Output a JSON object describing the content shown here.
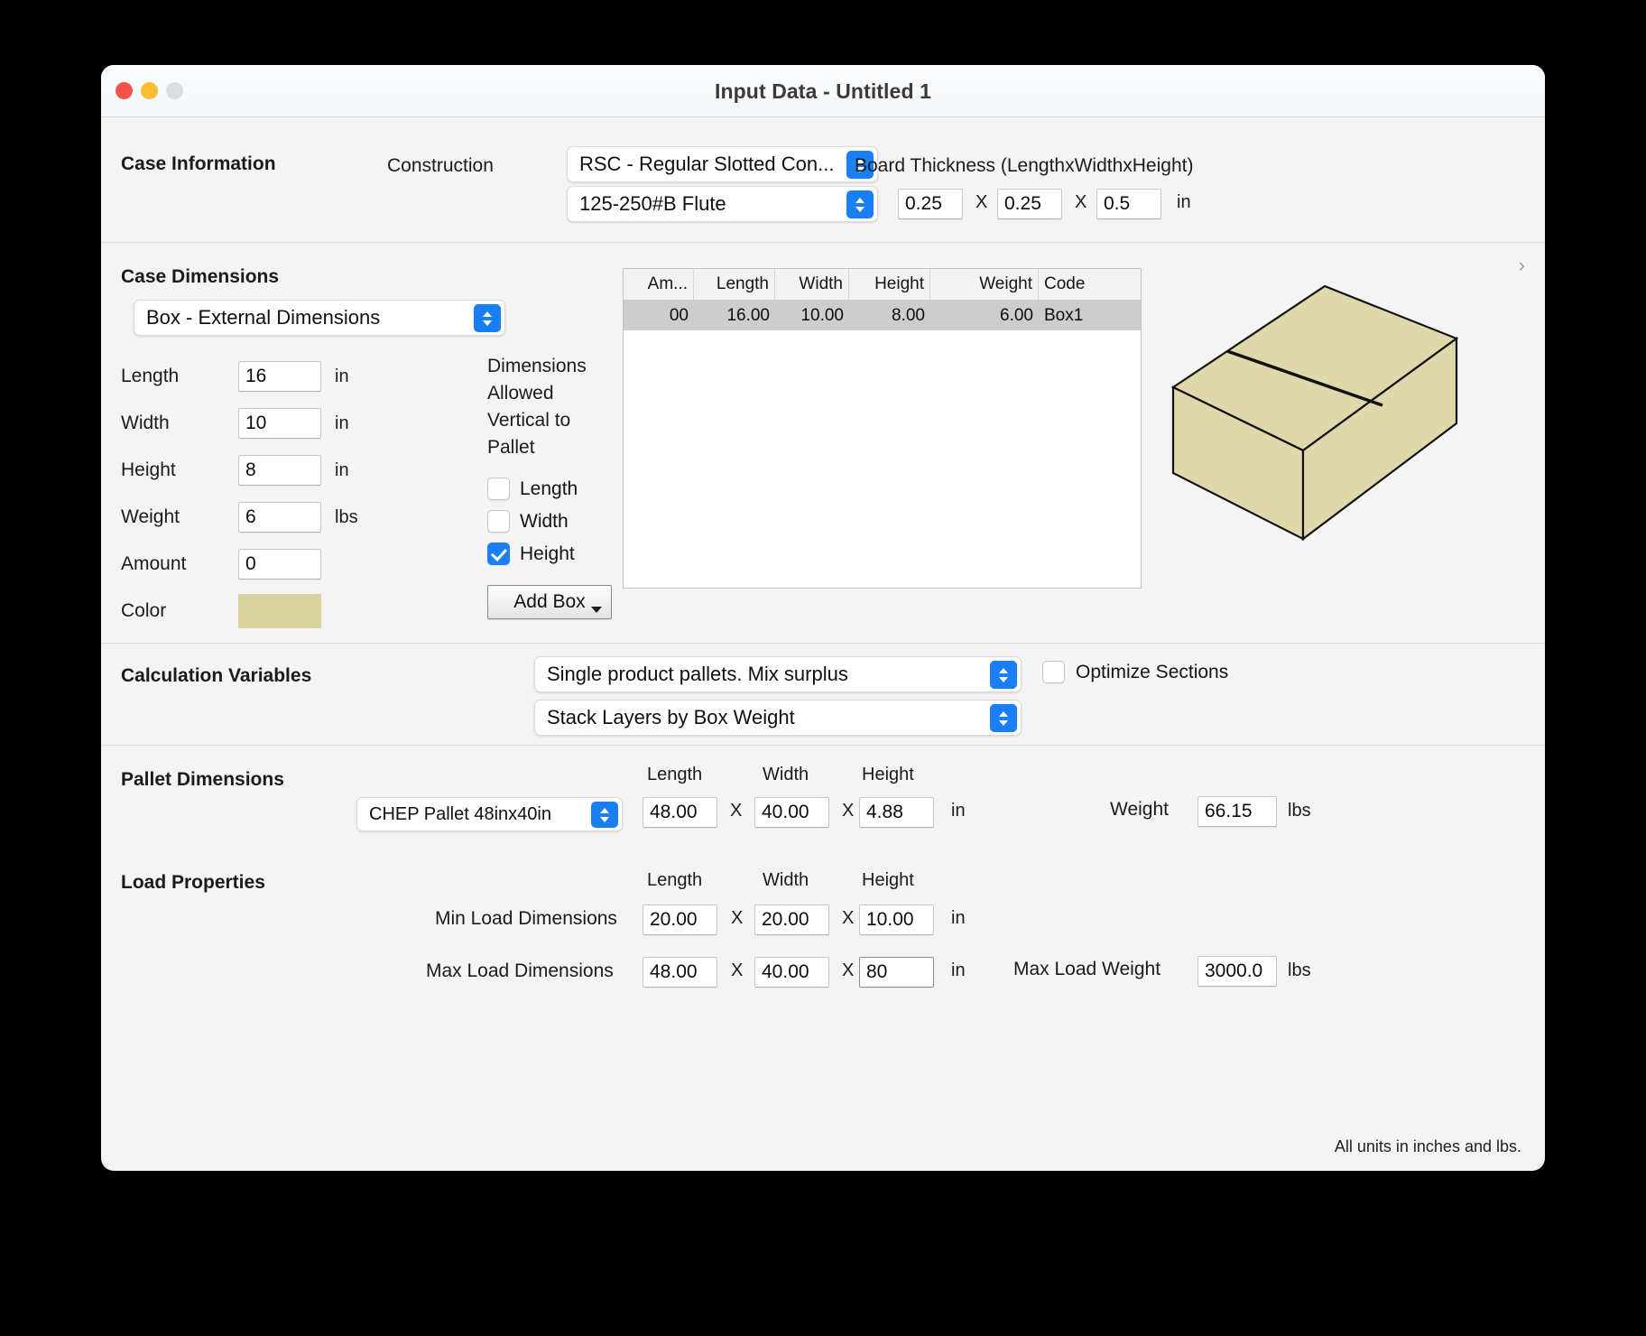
{
  "window": {
    "title": "Input Data - Untitled 1",
    "traffic_lights": [
      "close",
      "minimize",
      "zoom"
    ]
  },
  "case_information": {
    "title": "Case Information",
    "construction_label": "Construction",
    "construction_value": "RSC - Regular Slotted Con...",
    "flute_value": "125-250#B Flute",
    "board_thickness_label": "Board Thickness (LengthxWidthxHeight)",
    "thickness_length": "0.25",
    "thickness_width": "0.25",
    "thickness_height": "0.5",
    "x_sep": "X",
    "unit_in": "in"
  },
  "case_dimensions": {
    "title": "Case Dimensions",
    "mode_value": "Box - External Dimensions",
    "fields": [
      {
        "label": "Length",
        "value": "16",
        "unit": "in"
      },
      {
        "label": "Width",
        "value": "10",
        "unit": "in"
      },
      {
        "label": "Height",
        "value": "8",
        "unit": "in"
      },
      {
        "label": "Weight",
        "value": "6",
        "unit": "lbs"
      },
      {
        "label": "Amount",
        "value": "0",
        "unit": ""
      }
    ],
    "color_label": "Color",
    "color_value": "#d9d3a0",
    "vertical_title": "Dimensions Allowed Vertical to Pallet",
    "vertical_options": [
      {
        "label": "Length",
        "checked": false
      },
      {
        "label": "Width",
        "checked": false
      },
      {
        "label": "Height",
        "checked": true
      }
    ],
    "add_box_label": "Add Box",
    "table": {
      "columns": [
        "Am...",
        "Length",
        "Width",
        "Height",
        "Weight",
        "Code"
      ],
      "rows": [
        [
          "00",
          "16.00",
          "10.00",
          "8.00",
          "6.00",
          "Box1"
        ]
      ]
    }
  },
  "calculation_variables": {
    "title": "Calculation Variables",
    "strategy_value": "Single product pallets. Mix surplus",
    "stacking_value": "Stack Layers by Box Weight",
    "optimize_sections_label": "Optimize Sections",
    "optimize_sections_checked": false
  },
  "pallet_dimensions": {
    "title": "Pallet Dimensions",
    "pallet_value": "CHEP Pallet 48inx40in",
    "col_length": "Length",
    "col_width": "Width",
    "col_height": "Height",
    "length": "48.00",
    "width": "40.00",
    "height": "4.88",
    "unit_in": "in",
    "x_sep": "X",
    "weight_label": "Weight",
    "weight": "66.15",
    "weight_unit": "lbs"
  },
  "load_properties": {
    "title": "Load Properties",
    "col_length": "Length",
    "col_width": "Width",
    "col_height": "Height",
    "min_label": "Min Load Dimensions",
    "min_length": "20.00",
    "min_width": "20.00",
    "min_height": "10.00",
    "max_label": "Max Load Dimensions",
    "max_length": "48.00",
    "max_width": "40.00",
    "max_height": "80",
    "unit_in": "in",
    "x_sep": "X",
    "max_weight_label": "Max Load Weight",
    "max_weight": "3000.0",
    "max_weight_unit": "lbs"
  },
  "footer": {
    "note": "All units in inches and lbs."
  }
}
